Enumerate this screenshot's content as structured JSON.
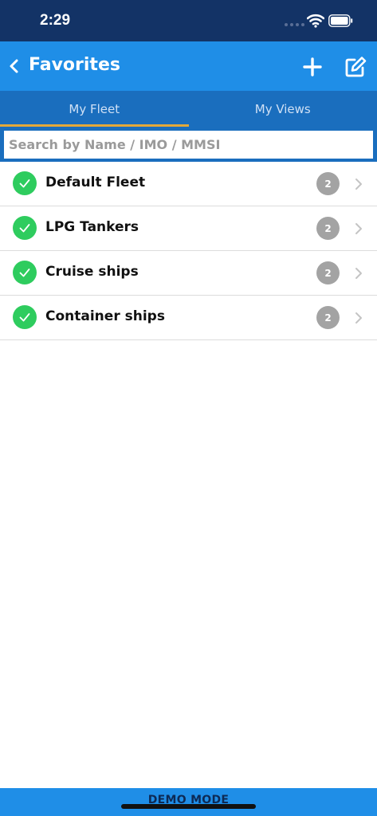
{
  "status_bar": {
    "time": "2:29",
    "icons": [
      "cellular-signal-icon",
      "wifi-icon",
      "battery-icon"
    ]
  },
  "nav_bar": {
    "back_icon": "chevron-left-icon",
    "title": "Favorites",
    "actions": [
      "plus-icon",
      "edit-icon"
    ]
  },
  "tabs": [
    {
      "label": "My Fleet",
      "active": true
    },
    {
      "label": "My Views",
      "active": false
    }
  ],
  "search": {
    "placeholder": "Search by Name / IMO / MMSI",
    "value": ""
  },
  "fleets": [
    {
      "name": "Default Fleet",
      "count": "2",
      "selected": true
    },
    {
      "name": "LPG Tankers",
      "count": "2",
      "selected": true
    },
    {
      "name": "Cruise ships",
      "count": "2",
      "selected": true
    },
    {
      "name": "Container ships",
      "count": "2",
      "selected": true
    }
  ],
  "footer": {
    "label": "DEMO MODE"
  },
  "colors": {
    "status_bar": "#133366",
    "nav_bar": "#1f8ee7",
    "tab_bar": "#1a6ebe",
    "tab_indicator": "#e2a83a",
    "check": "#2ecc5e",
    "badge": "#a3a3a3"
  }
}
